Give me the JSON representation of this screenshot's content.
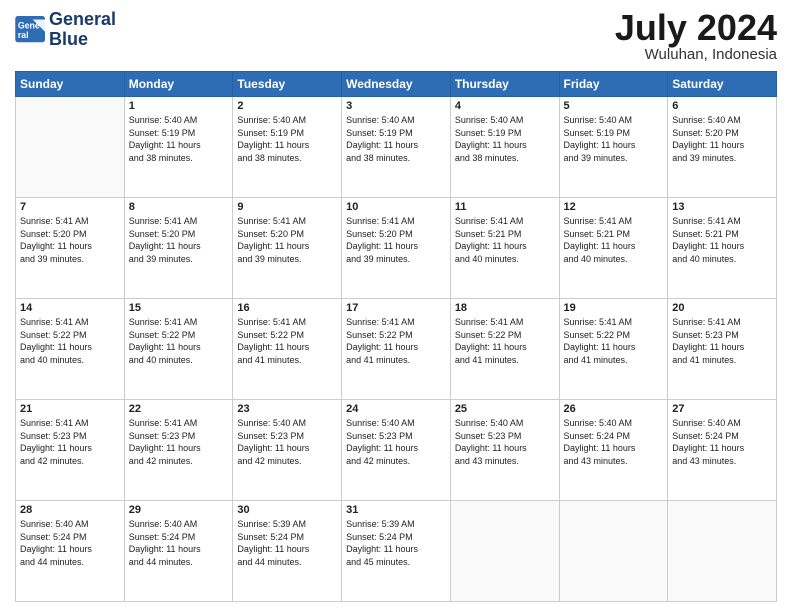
{
  "header": {
    "logo_line1": "General",
    "logo_line2": "Blue",
    "month_title": "July 2024",
    "location": "Wuluhan, Indonesia"
  },
  "weekdays": [
    "Sunday",
    "Monday",
    "Tuesday",
    "Wednesday",
    "Thursday",
    "Friday",
    "Saturday"
  ],
  "weeks": [
    [
      {
        "day": "",
        "info": ""
      },
      {
        "day": "1",
        "info": "Sunrise: 5:40 AM\nSunset: 5:19 PM\nDaylight: 11 hours\nand 38 minutes."
      },
      {
        "day": "2",
        "info": "Sunrise: 5:40 AM\nSunset: 5:19 PM\nDaylight: 11 hours\nand 38 minutes."
      },
      {
        "day": "3",
        "info": "Sunrise: 5:40 AM\nSunset: 5:19 PM\nDaylight: 11 hours\nand 38 minutes."
      },
      {
        "day": "4",
        "info": "Sunrise: 5:40 AM\nSunset: 5:19 PM\nDaylight: 11 hours\nand 38 minutes."
      },
      {
        "day": "5",
        "info": "Sunrise: 5:40 AM\nSunset: 5:19 PM\nDaylight: 11 hours\nand 39 minutes."
      },
      {
        "day": "6",
        "info": "Sunrise: 5:40 AM\nSunset: 5:20 PM\nDaylight: 11 hours\nand 39 minutes."
      }
    ],
    [
      {
        "day": "7",
        "info": "Sunrise: 5:41 AM\nSunset: 5:20 PM\nDaylight: 11 hours\nand 39 minutes."
      },
      {
        "day": "8",
        "info": "Sunrise: 5:41 AM\nSunset: 5:20 PM\nDaylight: 11 hours\nand 39 minutes."
      },
      {
        "day": "9",
        "info": "Sunrise: 5:41 AM\nSunset: 5:20 PM\nDaylight: 11 hours\nand 39 minutes."
      },
      {
        "day": "10",
        "info": "Sunrise: 5:41 AM\nSunset: 5:20 PM\nDaylight: 11 hours\nand 39 minutes."
      },
      {
        "day": "11",
        "info": "Sunrise: 5:41 AM\nSunset: 5:21 PM\nDaylight: 11 hours\nand 40 minutes."
      },
      {
        "day": "12",
        "info": "Sunrise: 5:41 AM\nSunset: 5:21 PM\nDaylight: 11 hours\nand 40 minutes."
      },
      {
        "day": "13",
        "info": "Sunrise: 5:41 AM\nSunset: 5:21 PM\nDaylight: 11 hours\nand 40 minutes."
      }
    ],
    [
      {
        "day": "14",
        "info": "Sunrise: 5:41 AM\nSunset: 5:22 PM\nDaylight: 11 hours\nand 40 minutes."
      },
      {
        "day": "15",
        "info": "Sunrise: 5:41 AM\nSunset: 5:22 PM\nDaylight: 11 hours\nand 40 minutes."
      },
      {
        "day": "16",
        "info": "Sunrise: 5:41 AM\nSunset: 5:22 PM\nDaylight: 11 hours\nand 41 minutes."
      },
      {
        "day": "17",
        "info": "Sunrise: 5:41 AM\nSunset: 5:22 PM\nDaylight: 11 hours\nand 41 minutes."
      },
      {
        "day": "18",
        "info": "Sunrise: 5:41 AM\nSunset: 5:22 PM\nDaylight: 11 hours\nand 41 minutes."
      },
      {
        "day": "19",
        "info": "Sunrise: 5:41 AM\nSunset: 5:22 PM\nDaylight: 11 hours\nand 41 minutes."
      },
      {
        "day": "20",
        "info": "Sunrise: 5:41 AM\nSunset: 5:23 PM\nDaylight: 11 hours\nand 41 minutes."
      }
    ],
    [
      {
        "day": "21",
        "info": "Sunrise: 5:41 AM\nSunset: 5:23 PM\nDaylight: 11 hours\nand 42 minutes."
      },
      {
        "day": "22",
        "info": "Sunrise: 5:41 AM\nSunset: 5:23 PM\nDaylight: 11 hours\nand 42 minutes."
      },
      {
        "day": "23",
        "info": "Sunrise: 5:40 AM\nSunset: 5:23 PM\nDaylight: 11 hours\nand 42 minutes."
      },
      {
        "day": "24",
        "info": "Sunrise: 5:40 AM\nSunset: 5:23 PM\nDaylight: 11 hours\nand 42 minutes."
      },
      {
        "day": "25",
        "info": "Sunrise: 5:40 AM\nSunset: 5:23 PM\nDaylight: 11 hours\nand 43 minutes."
      },
      {
        "day": "26",
        "info": "Sunrise: 5:40 AM\nSunset: 5:24 PM\nDaylight: 11 hours\nand 43 minutes."
      },
      {
        "day": "27",
        "info": "Sunrise: 5:40 AM\nSunset: 5:24 PM\nDaylight: 11 hours\nand 43 minutes."
      }
    ],
    [
      {
        "day": "28",
        "info": "Sunrise: 5:40 AM\nSunset: 5:24 PM\nDaylight: 11 hours\nand 44 minutes."
      },
      {
        "day": "29",
        "info": "Sunrise: 5:40 AM\nSunset: 5:24 PM\nDaylight: 11 hours\nand 44 minutes."
      },
      {
        "day": "30",
        "info": "Sunrise: 5:39 AM\nSunset: 5:24 PM\nDaylight: 11 hours\nand 44 minutes."
      },
      {
        "day": "31",
        "info": "Sunrise: 5:39 AM\nSunset: 5:24 PM\nDaylight: 11 hours\nand 45 minutes."
      },
      {
        "day": "",
        "info": ""
      },
      {
        "day": "",
        "info": ""
      },
      {
        "day": "",
        "info": ""
      }
    ]
  ]
}
